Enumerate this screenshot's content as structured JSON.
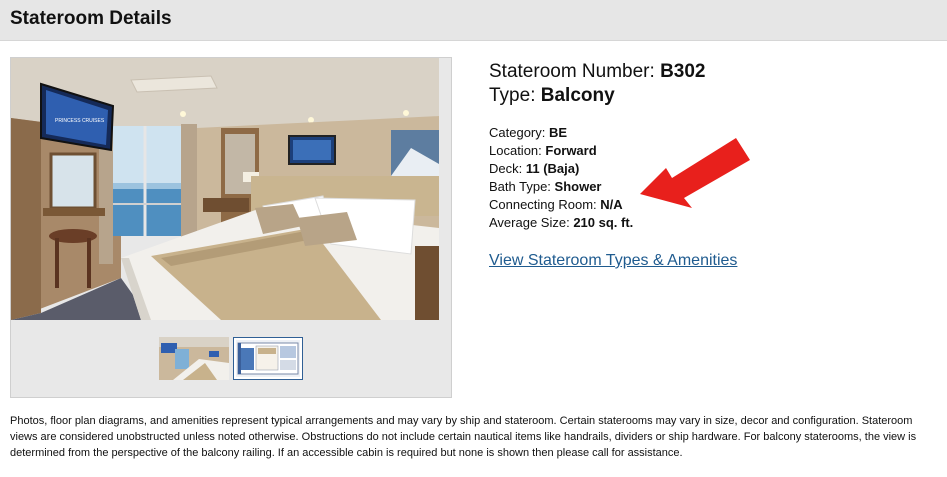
{
  "header": {
    "title": "Stateroom Details"
  },
  "stateroom": {
    "number_label": "Stateroom Number: ",
    "number": "B302",
    "type_label": "Type: ",
    "type": "Balcony",
    "facts": [
      {
        "label": "Category: ",
        "value": "BE"
      },
      {
        "label": "Location: ",
        "value": "Forward"
      },
      {
        "label": "Deck: ",
        "value": "11 (Baja)"
      },
      {
        "label": "Bath Type: ",
        "value": "Shower"
      },
      {
        "label": "Connecting Room: ",
        "value": "N/A"
      },
      {
        "label": "Average Size: ",
        "value": "210 sq. ft."
      }
    ],
    "amenities_link": "View Stateroom Types & Amenities"
  },
  "gallery": {
    "thumbnails": [
      "stateroom-photo",
      "floor-plan"
    ],
    "selected": "floor-plan",
    "tv_brand": "PRINCESS CRUISES"
  },
  "annotation": {
    "arrow_color": "#e8201c"
  },
  "disclaimer": "Photos, floor plan diagrams, and amenities represent typical arrangements and may vary by ship and stateroom. Certain staterooms may vary in size, decor and configuration. Stateroom views are considered unobstructed unless noted otherwise. Obstructions do not include certain nautical items like handrails, dividers or ship hardware. For balcony staterooms, the view is determined from the perspective of the balcony railing. If an accessible cabin is required but none is shown then please call for assistance."
}
